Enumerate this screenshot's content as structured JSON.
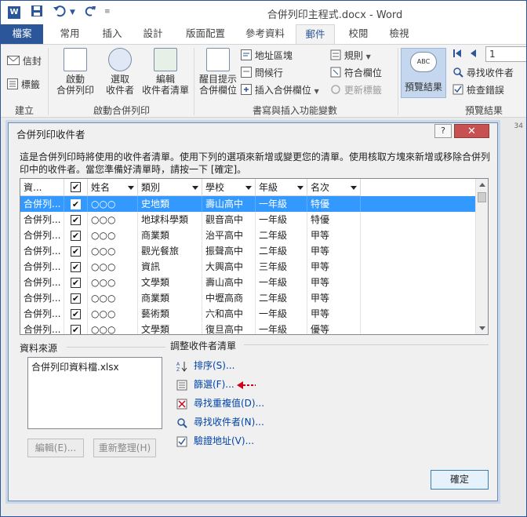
{
  "window": {
    "title": "合併列印主程式.docx - Word",
    "word_logo": "W"
  },
  "quick_access": {
    "save_icon": "save-icon",
    "undo_icon": "undo-icon",
    "redo_icon": "redo-icon"
  },
  "tabs": [
    {
      "label": "檔案"
    },
    {
      "label": "常用"
    },
    {
      "label": "插入"
    },
    {
      "label": "設計"
    },
    {
      "label": "版面配置"
    },
    {
      "label": "參考資料"
    },
    {
      "label": "郵件"
    },
    {
      "label": "校閱"
    },
    {
      "label": "檢視"
    }
  ],
  "ribbon": {
    "create": {
      "envelopes": "信封",
      "labels": "標籤",
      "group": "建立"
    },
    "start": {
      "start_line1": "啟動",
      "start_line2": "合併列印",
      "select_line1": "選取",
      "select_line2": "收件者",
      "edit_line1": "編輯",
      "edit_line2": "收件者清單",
      "group": "啟動合併列印"
    },
    "fields": {
      "highlight_line1": "醒目提示",
      "highlight_line2": "合併欄位",
      "address_block": "地址區塊",
      "greeting_line": "問候行",
      "insert_field": "插入合併欄位",
      "rules": "規則",
      "match_fields": "符合欄位",
      "update_labels": "更新標籤",
      "group": "書寫與插入功能變數"
    },
    "preview": {
      "preview_results": "預覽結果",
      "record_number": "1",
      "find_recipient": "尋找收件者",
      "check_errors": "檢查錯誤",
      "group": "預覽結果"
    },
    "ruler_fragment": "34"
  },
  "dialog": {
    "title": "合併列印收件者",
    "help": "?",
    "description": "這是合併列印時將使用的收件者清單。使用下列的選項來新增或變更您的清單。使用核取方塊來新增或移除合併列印中的收件者。當您準備好清單時，請按一下 [確定]。",
    "columns": [
      "資...",
      "",
      "姓名",
      "類別",
      "學校",
      "年級",
      "名次"
    ],
    "rows": [
      {
        "source": "合併列...",
        "checked": "✔",
        "name": "○○○",
        "category": "史地類",
        "school": "壽山高中",
        "grade": "一年級",
        "rank": "特優"
      },
      {
        "source": "合併列...",
        "checked": "✔",
        "name": "○○○",
        "category": "地球科學類",
        "school": "觀音高中",
        "grade": "一年級",
        "rank": "特優"
      },
      {
        "source": "合併列...",
        "checked": "✔",
        "name": "○○○",
        "category": "商業類",
        "school": "治平高中",
        "grade": "二年級",
        "rank": "甲等"
      },
      {
        "source": "合併列...",
        "checked": "✔",
        "name": "○○○",
        "category": "觀光餐旅",
        "school": "振聲高中",
        "grade": "二年級",
        "rank": "甲等"
      },
      {
        "source": "合併列...",
        "checked": "✔",
        "name": "○○○",
        "category": "資訊",
        "school": "大興高中",
        "grade": "三年級",
        "rank": "甲等"
      },
      {
        "source": "合併列...",
        "checked": "✔",
        "name": "○○○",
        "category": "文學類",
        "school": "壽山高中",
        "grade": "一年級",
        "rank": "甲等"
      },
      {
        "source": "合併列...",
        "checked": "✔",
        "name": "○○○",
        "category": "商業類",
        "school": "中壢高商",
        "grade": "二年級",
        "rank": "甲等"
      },
      {
        "source": "合併列...",
        "checked": "✔",
        "name": "○○○",
        "category": "藝術類",
        "school": "六和高中",
        "grade": "一年級",
        "rank": "甲等"
      },
      {
        "source": "合併列...",
        "checked": "✔",
        "name": "○○○",
        "category": "文學類",
        "school": "復旦高中",
        "grade": "一年級",
        "rank": "優等"
      }
    ],
    "data_source_label": "資料來源",
    "data_source_item": "合併列印資料檔.xlsx",
    "edit_button": "編輯(E)...",
    "refresh_button": "重新整理(H)",
    "refine_label": "調整收件者清單",
    "links": {
      "sort": "排序(S)...",
      "filter": "篩選(F)...",
      "duplicates": "尋找重複值(D)...",
      "find": "尋找收件者(N)...",
      "validate": "驗證地址(V)..."
    },
    "ok_button": "確定"
  },
  "colors": {
    "accent": "#2b579a",
    "selection": "#3399ff",
    "link": "#0044aa",
    "annotation_arrow": "#d0021b"
  }
}
